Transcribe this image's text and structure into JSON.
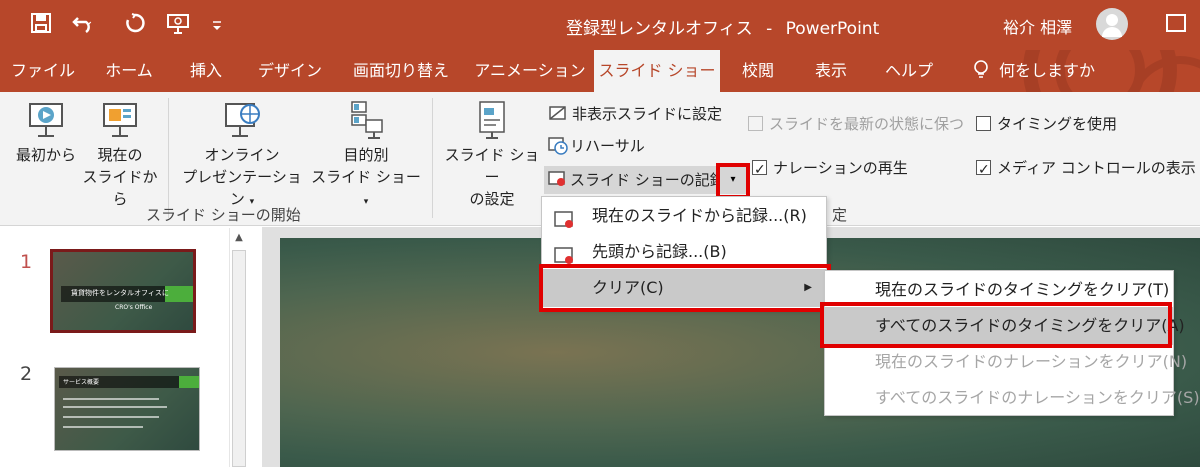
{
  "titlebar": {
    "save_icon": "save-icon",
    "undo_icon": "undo-icon",
    "redo_icon": "redo-icon",
    "present_icon": "present-from-beginning-icon",
    "customize_icon": "customize-qat-icon",
    "document_title": "登録型レンタルオフィス",
    "separator": "-",
    "app_name": "PowerPoint",
    "user_name": "裕介 相澤",
    "colors": {
      "brand": "#b7472a"
    }
  },
  "tabs": [
    {
      "label": "ファイル"
    },
    {
      "label": "ホーム"
    },
    {
      "label": "挿入"
    },
    {
      "label": "デザイン"
    },
    {
      "label": "画面切り替え"
    },
    {
      "label": "アニメーション"
    },
    {
      "label": "スライド ショー",
      "active": true
    },
    {
      "label": "校閲"
    },
    {
      "label": "表示"
    },
    {
      "label": "ヘルプ"
    },
    {
      "label": "何をしますか"
    }
  ],
  "ribbon": {
    "start_group": {
      "from_beginning": "最初から",
      "from_current_line1": "現在の",
      "from_current_line2": "スライドから",
      "online_line1": "オンライン",
      "online_line2": "プレゼンテーション",
      "custom_line1": "目的別",
      "custom_line2": "スライド ショー",
      "label": "スライド ショーの開始"
    },
    "setup_group": {
      "setup_line1": "スライド ショー",
      "setup_line2": "の設定",
      "hide_slide": "非表示スライドに設定",
      "rehearse": "リハーサル",
      "record": "スライド ショーの記録",
      "keep_updated": "スライドを最新の状態に保つ",
      "use_timings": "タイミングを使用",
      "play_narrations": "ナレーションの再生",
      "show_media_controls": "メディア コントロールの表示",
      "label_partial": "定"
    }
  },
  "record_menu": {
    "items": [
      {
        "label": "現在のスライドから記録...(R)"
      },
      {
        "label": "先頭から記録...(B)"
      },
      {
        "label": "クリア(C)"
      }
    ]
  },
  "clear_submenu": {
    "items": [
      {
        "label": "現在のスライドのタイミングをクリア(T)",
        "enabled": true
      },
      {
        "label": "すべてのスライドのタイミングをクリア(A)",
        "enabled": true,
        "highlighted": true
      },
      {
        "label": "現在のスライドのナレーションをクリア(N)",
        "enabled": false
      },
      {
        "label": "すべてのスライドのナレーションをクリア(S)",
        "enabled": false
      }
    ]
  },
  "slides": [
    {
      "number": "1",
      "title": "賃貸物件をレンタルオフィスに",
      "subtitle": "CRO's Office"
    },
    {
      "number": "2",
      "title": "サービス概要"
    }
  ]
}
